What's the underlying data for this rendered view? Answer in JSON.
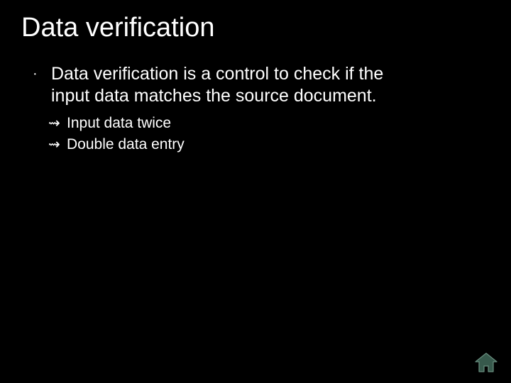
{
  "slide": {
    "title": "Data verification",
    "bullets": [
      {
        "text": "Data verification is a control to check if the input data matches the source document.",
        "children": [
          {
            "text": "Input data twice"
          },
          {
            "text": "Double data entry"
          }
        ]
      }
    ]
  },
  "nav": {
    "home_label": "Home"
  },
  "colors": {
    "background": "#000000",
    "text": "#ffffff",
    "home_fill": "#37594c",
    "home_stroke": "#6a8f80"
  }
}
